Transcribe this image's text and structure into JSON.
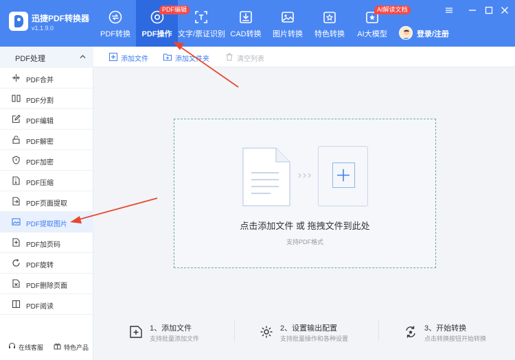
{
  "app": {
    "title": "迅捷PDF转换器",
    "version": "v1.1.9.0"
  },
  "nav": [
    {
      "label": "PDF转换",
      "icon": "pdf-convert-icon"
    },
    {
      "label": "PDF操作",
      "icon": "pdf-operate-icon",
      "badge": "PDF编辑",
      "active": true
    },
    {
      "label": "文字/票证识别",
      "icon": "text-recognition-icon"
    },
    {
      "label": "CAD转换",
      "icon": "cad-convert-icon"
    },
    {
      "label": "图片转换",
      "icon": "image-convert-icon"
    },
    {
      "label": "特色转换",
      "icon": "special-convert-icon"
    },
    {
      "label": "AI大模型",
      "icon": "ai-model-icon",
      "badge": "AI解读文档"
    }
  ],
  "user": {
    "login_label": "登录/注册"
  },
  "sidebar": {
    "title": "PDF处理",
    "items": [
      {
        "label": "PDF合并",
        "icon": "merge-icon"
      },
      {
        "label": "PDF分割",
        "icon": "split-icon"
      },
      {
        "label": "PDF编辑",
        "icon": "edit-icon"
      },
      {
        "label": "PDF解密",
        "icon": "unlock-icon"
      },
      {
        "label": "PDF加密",
        "icon": "shield-icon"
      },
      {
        "label": "PDF压缩",
        "icon": "compress-icon"
      },
      {
        "label": "PDF页面提取",
        "icon": "page-extract-icon"
      },
      {
        "label": "PDF提取图片",
        "icon": "image-extract-icon",
        "active": true
      },
      {
        "label": "PDF加页码",
        "icon": "page-number-icon"
      },
      {
        "label": "PDF旋转",
        "icon": "rotate-icon"
      },
      {
        "label": "PDF删除页面",
        "icon": "delete-page-icon"
      },
      {
        "label": "PDF阅读",
        "icon": "read-icon"
      }
    ],
    "footer": {
      "service": "在线客服",
      "features": "特色产品"
    }
  },
  "toolbar": {
    "add_file": "添加文件",
    "add_folder": "添加文件夹",
    "clear_list": "清空列表"
  },
  "dropzone": {
    "main_text": "点击添加文件 或 拖拽文件到此处",
    "sub_text": "支持PDF格式"
  },
  "steps": [
    {
      "title": "1、添加文件",
      "desc": "支持批量添加文件"
    },
    {
      "title": "2、设置输出配置",
      "desc": "支持批量操作和各种设置"
    },
    {
      "title": "3、开始转换",
      "desc": "点击转换按钮开始转换"
    }
  ],
  "colors": {
    "header": "#4a86f2",
    "nav_active": "#2d6ae0",
    "accent": "#3c7cf0",
    "badge": "#f24b4b",
    "annotation_arrow": "#e8472f"
  }
}
